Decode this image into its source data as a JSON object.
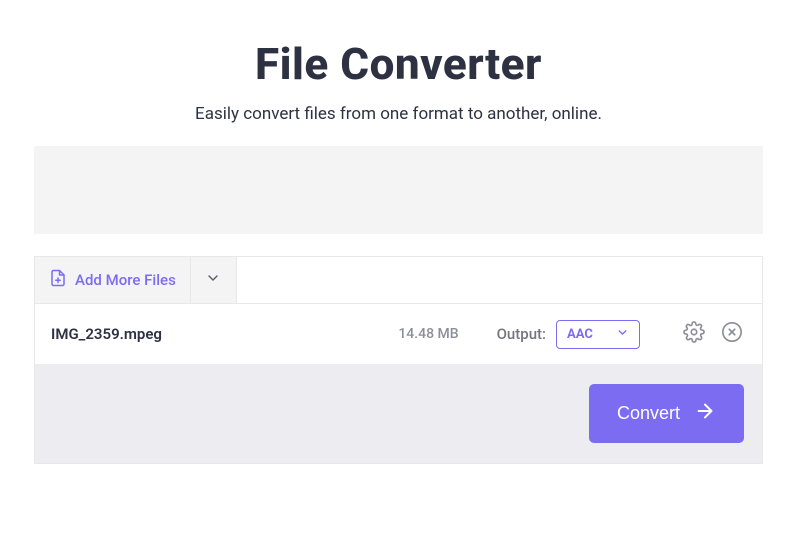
{
  "header": {
    "title": "File Converter",
    "subtitle": "Easily convert files from one format to another, online."
  },
  "toolbar": {
    "add_more_label": "Add More Files"
  },
  "file": {
    "name": "IMG_2359.mpeg",
    "size": "14.48 MB",
    "output_label": "Output:",
    "output_format": "AAC"
  },
  "footer": {
    "convert_label": "Convert"
  },
  "colors": {
    "accent": "#7c6cf2"
  }
}
